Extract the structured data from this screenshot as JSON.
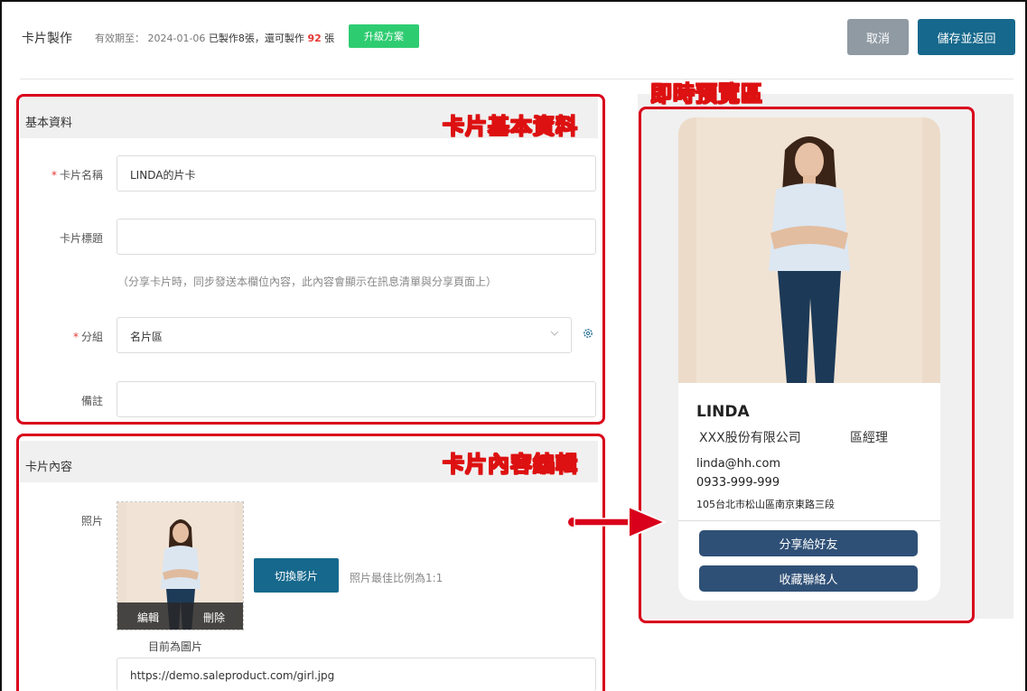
{
  "header": {
    "title": "卡片製作",
    "validity_label": "有效期至：",
    "validity_date": "2024-01-06",
    "made_text": "已製作8張，還可製作",
    "remain_count": "92",
    "remain_unit": "張",
    "upgrade_label": "升級方案",
    "cancel_label": "取消",
    "save_label": "儲存並返回"
  },
  "annotations": {
    "basic_info_callout": "卡片基本資料",
    "content_callout": "卡片內容編輯",
    "preview_callout": "即時預覽區",
    "highlight_color": "#d9001b"
  },
  "basic_info": {
    "section_title": "基本資料",
    "card_name_label": "卡片名稱",
    "card_name_value": "LINDA的片卡",
    "card_title_label": "卡片標題",
    "card_title_value": "",
    "title_hint": "（分享卡片時，同步發送本欄位內容，此內容會顯示在訊息清單與分享頁面上）",
    "group_label": "分組",
    "group_value": "名片區",
    "note_label": "備註",
    "note_value": "",
    "required_mark": "*"
  },
  "content": {
    "section_title": "卡片內容",
    "photo_label": "照片",
    "edit_label": "編輯",
    "delete_label": "刪除",
    "switch_label": "切換影片",
    "photo_tip": "照片最佳比例為1:1",
    "current_type": "目前為圖片",
    "photo_url": "https://demo.saleproduct.com/girl.jpg"
  },
  "preview": {
    "name": "LINDA",
    "company": "XXX股份有限公司",
    "role": "區經理",
    "email": "linda@hh.com",
    "phone": "0933-999-999",
    "address": "105台北市松山區南京東路三段",
    "share_label": "分享給好友",
    "save_contact_label": "收藏聯絡人"
  },
  "colors": {
    "primary": "#16688c",
    "upgrade": "#2ecc71",
    "card_button": "#2f5076",
    "cancel": "#8f9aa3"
  }
}
